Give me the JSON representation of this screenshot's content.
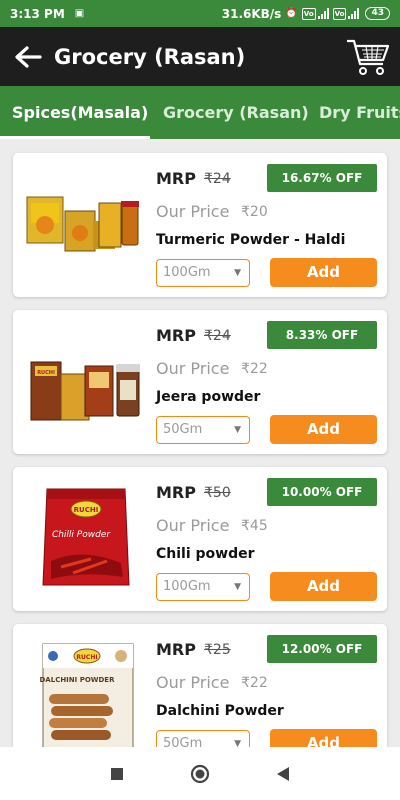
{
  "status_bar": {
    "time": "3:13 PM",
    "speed": "31.6KB/s",
    "battery": "43"
  },
  "app_bar": {
    "title": "Grocery (Rasan)"
  },
  "tabs": [
    {
      "label": "Spices(Masala)",
      "active": true
    },
    {
      "label": "Grocery (Rasan)",
      "active": false
    },
    {
      "label": "Dry Fruits",
      "active": false
    }
  ],
  "labels": {
    "mrp": "MRP",
    "our_price": "Our Price",
    "add": "Add"
  },
  "products": [
    {
      "name": "Turmeric Powder - Haldi",
      "mrp": "₹24",
      "price": "₹20",
      "discount": "16.67% OFF",
      "qty": "100Gm"
    },
    {
      "name": "Jeera powder",
      "mrp": "₹24",
      "price": "₹22",
      "discount": "8.33% OFF",
      "qty": "50Gm"
    },
    {
      "name": "Chili powder",
      "mrp": "₹50",
      "price": "₹45",
      "discount": "10.00% OFF",
      "qty": "100Gm"
    },
    {
      "name": "Dalchini Powder",
      "mrp": "₹25",
      "price": "₹22",
      "discount": "12.00% OFF",
      "qty": "50Gm"
    }
  ],
  "product_images": [
    {
      "logo_text": ""
    },
    {
      "logo_text": "RUCHI"
    },
    {
      "logo_text": "RUCHI",
      "label_text": "Chilli Powder"
    },
    {
      "logo_text": "RUCHI",
      "label_text": "DALCHINI POWDER"
    }
  ],
  "colors": {
    "primary_green": "#3b8a3c",
    "appbar_dark": "#1e1e1e",
    "accent_orange": "#f68b1e"
  }
}
